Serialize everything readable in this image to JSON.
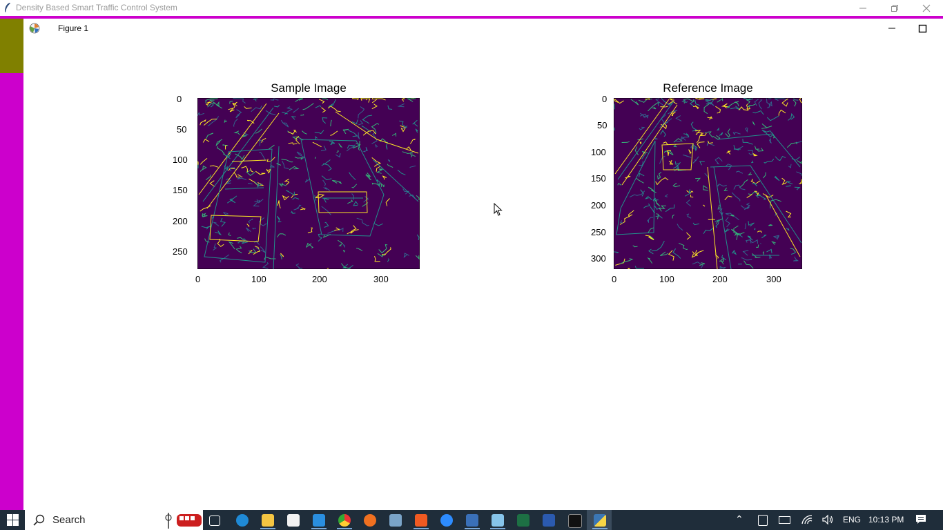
{
  "window": {
    "title": "Density Based Smart Traffic Control System"
  },
  "figure": {
    "title": "Figure 1"
  },
  "plots": [
    {
      "title": "Sample Image",
      "xticks": [
        "0",
        "100",
        "200",
        "300"
      ],
      "yticks": [
        "0",
        "50",
        "100",
        "150",
        "200",
        "250"
      ],
      "xlim": [
        0,
        360
      ],
      "ylim": [
        280,
        0
      ]
    },
    {
      "title": "Reference Image",
      "xticks": [
        "0",
        "100",
        "200",
        "300"
      ],
      "yticks": [
        "0",
        "50",
        "100",
        "150",
        "200",
        "250",
        "300"
      ],
      "xlim": [
        0,
        353
      ],
      "ylim": [
        320,
        0
      ]
    }
  ],
  "taskbar": {
    "search_label": "Search",
    "language": "ENG",
    "time": "10:13 PM",
    "apps": [
      "task-view",
      "edge",
      "file-explorer",
      "app",
      "vscode",
      "chrome",
      "search-app",
      "app",
      "brave",
      "zoom",
      "app",
      "notepad",
      "excel",
      "word",
      "terminal",
      "python"
    ]
  },
  "colors": {
    "accent": "#cc00cc",
    "strip": "#808000",
    "plot_bg": "#440154",
    "edge_1": "#21918c",
    "edge_2": "#fde725"
  }
}
